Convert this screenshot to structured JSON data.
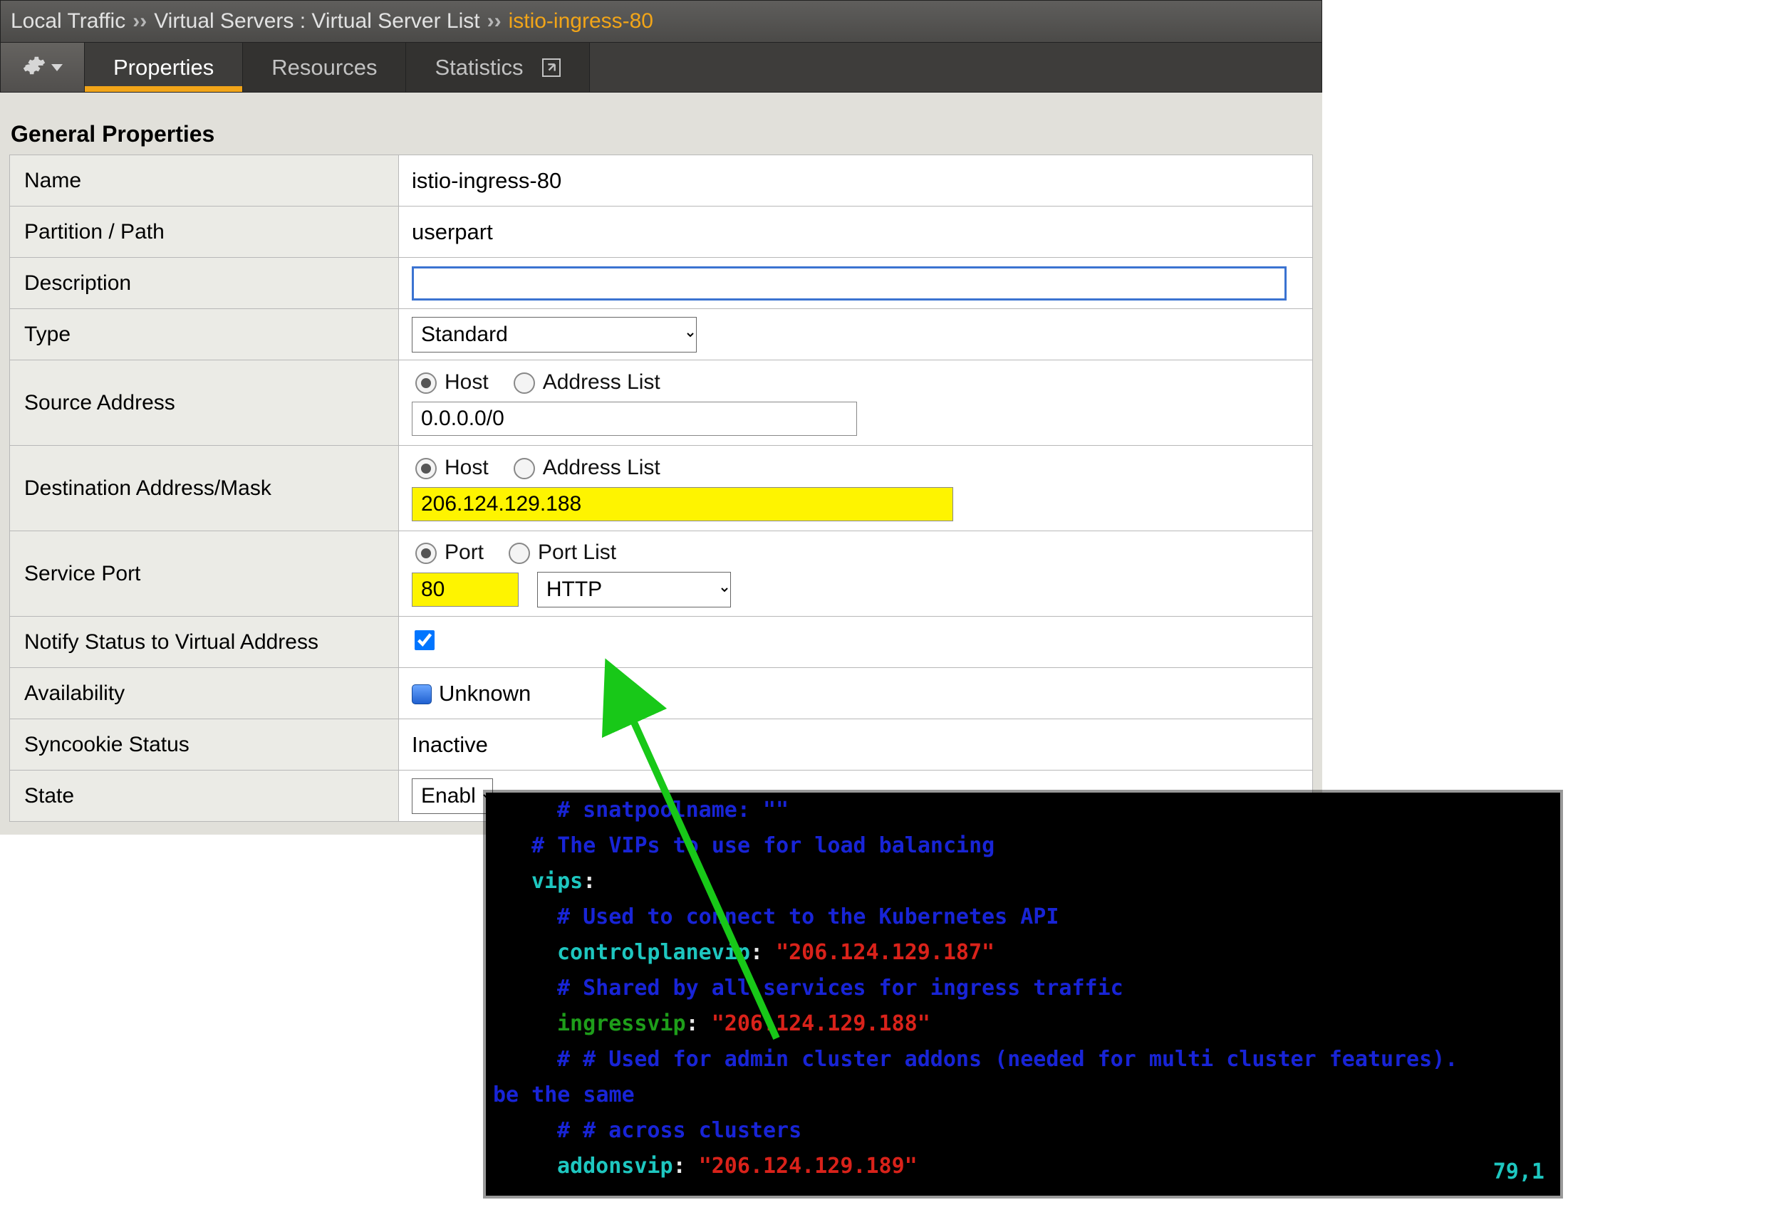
{
  "breadcrumb": {
    "section": "Local Traffic",
    "sep": "››",
    "sub1": "Virtual Servers : Virtual Server List",
    "current": "istio-ingress-80"
  },
  "tabs": {
    "properties": "Properties",
    "resources": "Resources",
    "statistics": "Statistics"
  },
  "section_title": "General Properties",
  "rows": {
    "name": {
      "label": "Name",
      "value": "istio-ingress-80"
    },
    "partition": {
      "label": "Partition / Path",
      "value": "userpart"
    },
    "description": {
      "label": "Description",
      "value": ""
    },
    "type": {
      "label": "Type",
      "value": "Standard"
    },
    "source": {
      "label": "Source Address",
      "radio_host": "Host",
      "radio_list": "Address List",
      "value": "0.0.0.0/0"
    },
    "dest": {
      "label": "Destination Address/Mask",
      "radio_host": "Host",
      "radio_list": "Address List",
      "value": "206.124.129.188"
    },
    "port": {
      "label": "Service Port",
      "radio_port": "Port",
      "radio_list": "Port List",
      "value": "80",
      "protocol": "HTTP"
    },
    "notify": {
      "label": "Notify Status to Virtual Address"
    },
    "availability": {
      "label": "Availability",
      "value": "Unknown"
    },
    "syncookie": {
      "label": "Syncookie Status",
      "value": "Inactive"
    },
    "state": {
      "label": "State",
      "value": "Enabled"
    }
  },
  "terminal": {
    "snat": "# snatpoolname: \"\"",
    "vips_cmt": "# The VIPs to use for load balancing",
    "vips_key": "vips",
    "cp_cmt": "# Used to connect to the Kubernetes API",
    "cp_key": "controlplanevip",
    "cp_val": "\"206.124.129.187\"",
    "ing_cmt": "# Shared by all services for ingress traffic",
    "ing_key": "ingressvip",
    "ing_val": "\"206.124.129.188\"",
    "addon_cmt1": "# # Used for admin cluster addons (needed for multi cluster features).",
    "addon_cmt1b": "be the same",
    "addon_cmt2": "# # across clusters",
    "addon_key": "addonsvip",
    "addon_val": "\"206.124.129.189\"",
    "cursor": "79,1"
  }
}
